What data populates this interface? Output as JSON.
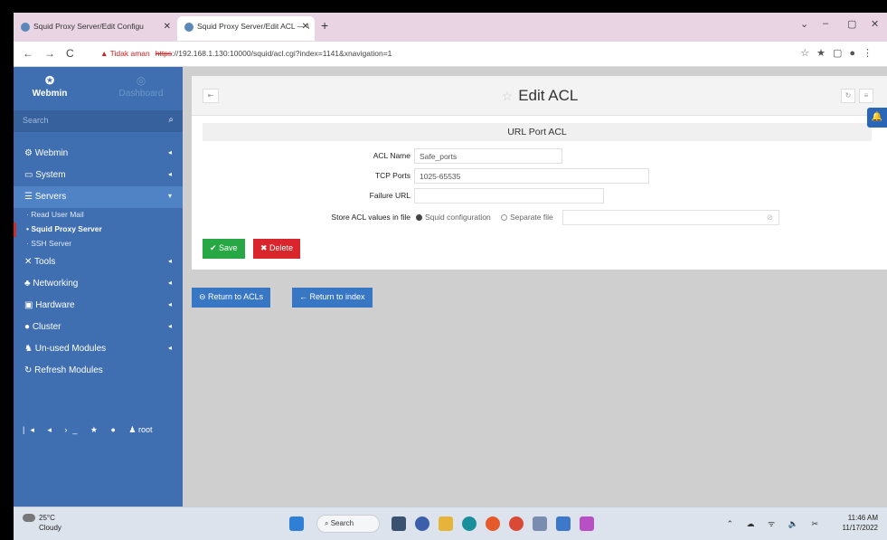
{
  "browser": {
    "tab1_title": "Squid Proxy Server/Edit Configu",
    "tab2_title": "Squid Proxy Server/Edit ACL — \\",
    "new_tab": "+",
    "not_secure": "Tidak aman",
    "url_scheme": "https",
    "url_rest": "://192.168.1.130:10000/squid/acl.cgi?index=1141&xnavigation=1"
  },
  "sidebar": {
    "brand": "Webmin",
    "dashboard": "Dashboard",
    "search_placeholder": "Search",
    "items": [
      {
        "label": "Webmin",
        "icon": "gear-icon"
      },
      {
        "label": "System",
        "icon": "monitor-icon"
      },
      {
        "label": "Servers",
        "icon": "server-icon"
      },
      {
        "label": "Tools",
        "icon": "tools-icon"
      },
      {
        "label": "Networking",
        "icon": "network-icon"
      },
      {
        "label": "Hardware",
        "icon": "hardware-icon"
      },
      {
        "label": "Cluster",
        "icon": "cluster-icon"
      },
      {
        "label": "Un-used Modules",
        "icon": "puzzle-icon"
      },
      {
        "label": "Refresh Modules",
        "icon": "refresh-icon"
      }
    ],
    "sub_items": [
      "Read User Mail",
      "Squid Proxy Server",
      "SSH Server"
    ],
    "user": "root"
  },
  "page": {
    "title": "Edit ACL",
    "form_title": "URL Port ACL",
    "acl_name_label": "ACL Name",
    "acl_name_value": "Safe_ports",
    "tcp_ports_label": "TCP Ports",
    "tcp_ports_value": "1025-65535",
    "failure_url_label": "Failure URL",
    "failure_url_value": "",
    "store_label": "Store ACL values in file",
    "store_opt1": "Squid configuration",
    "store_opt2": "Separate file",
    "store_selected": "Squid configuration",
    "save_label": "Save",
    "delete_label": "Delete",
    "return_acls": "Return to ACLs",
    "return_index": "Return to index"
  },
  "taskbar": {
    "temp": "25°C",
    "weather": "Cloudy",
    "search": "Search",
    "time": "11:46 AM",
    "date": "11/17/2022"
  },
  "colors": {
    "sidebar": "#3f6fb0",
    "save": "#28a745",
    "delete": "#d9262c",
    "action": "#3877c4"
  }
}
